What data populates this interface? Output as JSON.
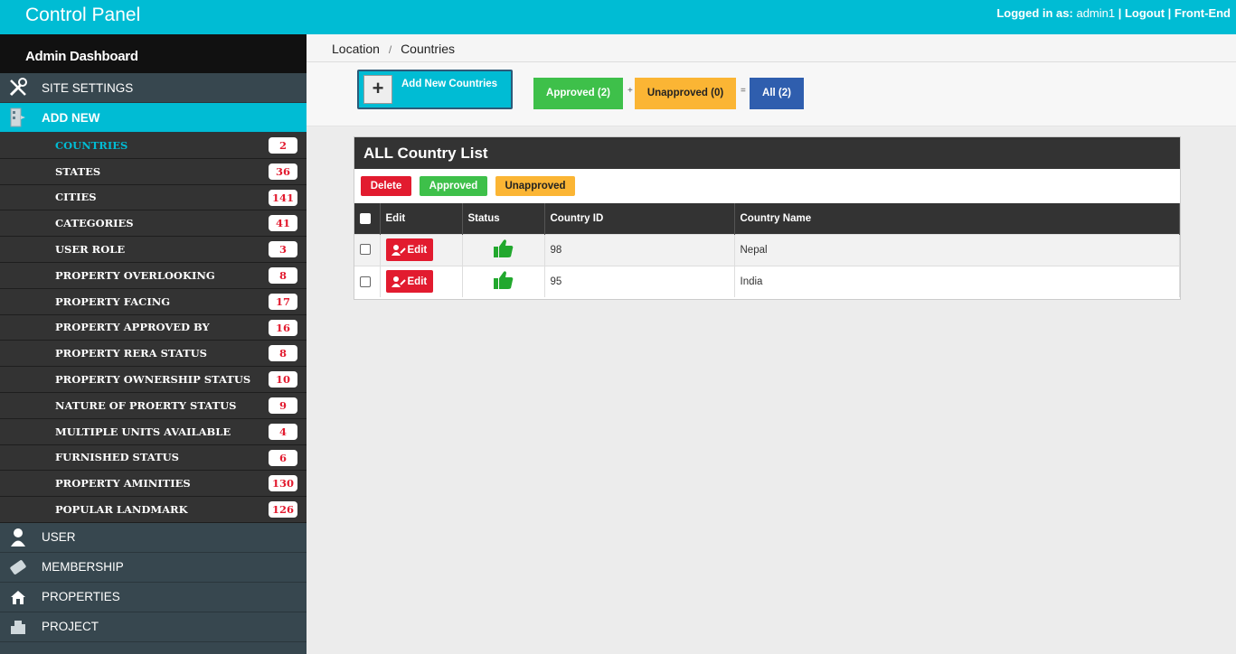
{
  "topbar": {
    "title": "Control Panel",
    "logged_in_label": "Logged in as:",
    "username": "admin1",
    "logout": "Logout",
    "frontend": "Front-End"
  },
  "sidebar": {
    "header": "Admin Dashboard",
    "site_settings": "SITE SETTINGS",
    "add_new": "ADD NEW",
    "sub_items": [
      {
        "label": "COUNTRIES",
        "count": "2"
      },
      {
        "label": "STATES",
        "count": "36"
      },
      {
        "label": "CITIES",
        "count": "141"
      },
      {
        "label": "CATEGORIES",
        "count": "41"
      },
      {
        "label": "USER ROLE",
        "count": "3"
      },
      {
        "label": "PROPERTY OVERLOOKING",
        "count": "8"
      },
      {
        "label": "PROPERTY FACING",
        "count": "17"
      },
      {
        "label": "PROPERTY APPROVED BY",
        "count": "16"
      },
      {
        "label": "PROPERTY RERA STATUS",
        "count": "8"
      },
      {
        "label": "PROPERTY OWNERSHIP STATUS",
        "count": "10"
      },
      {
        "label": "NATURE OF PROERTY STATUS",
        "count": "9"
      },
      {
        "label": "MULTIPLE UNITS AVAILABLE",
        "count": "4"
      },
      {
        "label": "FURNISHED STATUS",
        "count": "6"
      },
      {
        "label": "PROPERTY AMINITIES",
        "count": "130"
      },
      {
        "label": "POPULAR LANDMARK",
        "count": "126"
      }
    ],
    "user": "USER",
    "membership": "MEMBERSHIP",
    "properties": "PROPERTIES",
    "project": "PROJECT"
  },
  "breadcrumb": {
    "parent": "Location",
    "separator": "/",
    "current": "Countries"
  },
  "actions": {
    "add_new": "Add New Countries",
    "approved": "Approved (2)",
    "plus": "+",
    "unapproved": "Unapproved (0)",
    "equals": "=",
    "all": "All (2)"
  },
  "panel": {
    "title": "ALL Country List",
    "delete": "Delete",
    "approved": "Approved",
    "unapproved": "Unapproved",
    "columns": {
      "edit": "Edit",
      "status": "Status",
      "id": "Country ID",
      "name": "Country Name"
    },
    "edit_label": "Edit",
    "rows": [
      {
        "id": "98",
        "name": "Nepal"
      },
      {
        "id": "95",
        "name": "India"
      }
    ]
  },
  "colors": {
    "accent": "#00bcd4",
    "danger": "#e21b2f",
    "success": "#3ec04a",
    "warning": "#fbb534",
    "primary": "#2f5eae"
  },
  "icons": {
    "site_settings": "tools-icon",
    "add_new": "document-add-icon",
    "user": "user-icon",
    "membership": "card-icon",
    "properties": "house-icon",
    "project": "building-icon",
    "status": "thumbs-up-icon",
    "edit": "user-edit-icon"
  }
}
